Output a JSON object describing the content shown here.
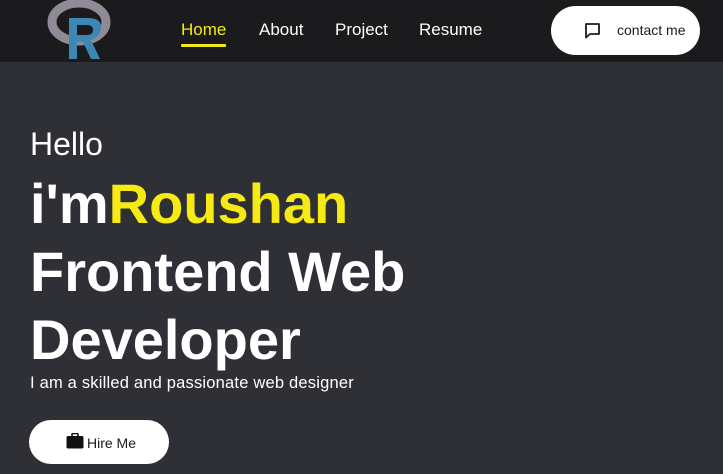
{
  "header": {
    "logo": {
      "icon": "r-logo-icon"
    },
    "nav": [
      {
        "id": "home",
        "label": "Home",
        "active": true
      },
      {
        "id": "about",
        "label": "About",
        "active": false
      },
      {
        "id": "project",
        "label": "Project",
        "active": false
      },
      {
        "id": "resume",
        "label": "Resume",
        "active": false
      }
    ],
    "contact_button": {
      "label": "contact me",
      "icon": "chat-icon"
    }
  },
  "hero": {
    "greeting": "Hello",
    "prefix": "i'm",
    "name": "Roushan",
    "role_line1": "Frontend Web",
    "role_line2": "Developer",
    "tagline": "I am a skilled and passionate web designer",
    "hire_button": {
      "label": "Hire Me",
      "icon": "briefcase-icon"
    }
  },
  "colors": {
    "nav_background": "#1b1b1d",
    "page_background": "#2f2f36",
    "accent": "#f5ea14",
    "logo_ring": "#8f8a96",
    "logo_letter": "#3e86b3",
    "button_background": "#ffffff"
  }
}
